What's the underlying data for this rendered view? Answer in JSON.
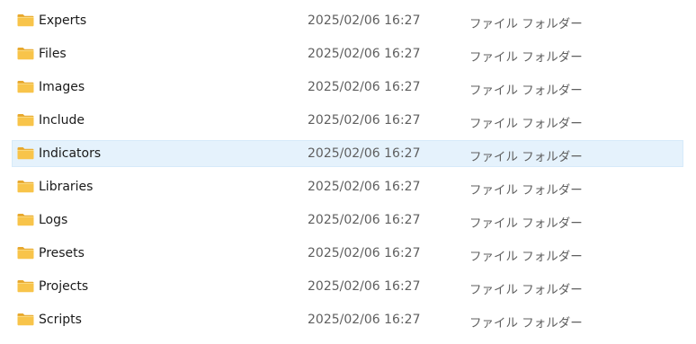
{
  "files": [
    {
      "name": "Experts",
      "date": "2025/02/06 16:27",
      "type": "ファイル フォルダー",
      "selected": false
    },
    {
      "name": "Files",
      "date": "2025/02/06 16:27",
      "type": "ファイル フォルダー",
      "selected": false
    },
    {
      "name": "Images",
      "date": "2025/02/06 16:27",
      "type": "ファイル フォルダー",
      "selected": false
    },
    {
      "name": "Include",
      "date": "2025/02/06 16:27",
      "type": "ファイル フォルダー",
      "selected": false
    },
    {
      "name": "Indicators",
      "date": "2025/02/06 16:27",
      "type": "ファイル フォルダー",
      "selected": true
    },
    {
      "name": "Libraries",
      "date": "2025/02/06 16:27",
      "type": "ファイル フォルダー",
      "selected": false
    },
    {
      "name": "Logs",
      "date": "2025/02/06 16:27",
      "type": "ファイル フォルダー",
      "selected": false
    },
    {
      "name": "Presets",
      "date": "2025/02/06 16:27",
      "type": "ファイル フォルダー",
      "selected": false
    },
    {
      "name": "Projects",
      "date": "2025/02/06 16:27",
      "type": "ファイル フォルダー",
      "selected": false
    },
    {
      "name": "Scripts",
      "date": "2025/02/06 16:27",
      "type": "ファイル フォルダー",
      "selected": false
    }
  ],
  "icon": "folder-icon",
  "colors": {
    "folder_body": "#f8c44a",
    "folder_tab": "#e8a82c",
    "selection_bg": "#e5f2fc"
  }
}
